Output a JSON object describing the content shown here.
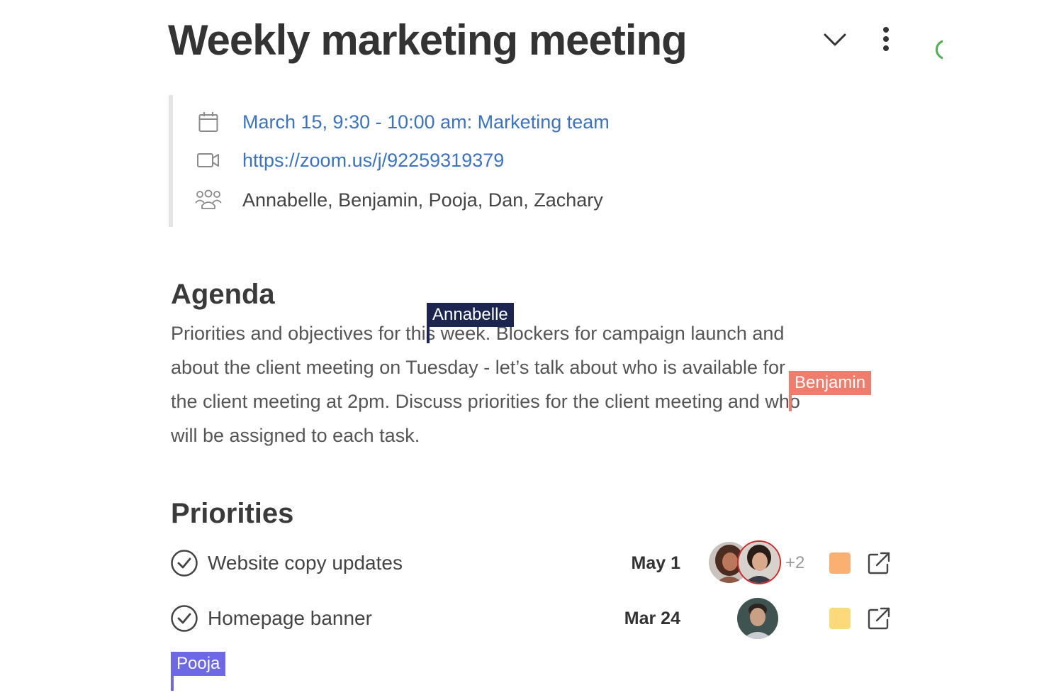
{
  "page": {
    "title": "Weekly marketing meeting",
    "icons": {
      "collapse": "chevron-down-icon",
      "more": "more-vertical-icon"
    }
  },
  "meeting": {
    "event": {
      "icon": "calendar-icon",
      "text": "March 15, 9:30 - 10:00 am: Marketing team"
    },
    "video": {
      "icon": "video-camera-icon",
      "text": "https://zoom.us/j/92259319379"
    },
    "attendees": {
      "icon": "people-icon",
      "text": "Annabelle, Benjamin, Pooja, Dan, Zachary"
    }
  },
  "agenda": {
    "heading": "Agenda",
    "lines": [
      {
        "before_cursor": "Priorities and objectives for",
        "after_cursor": "this week. Blockers for campaign launch and"
      },
      {
        "text": "about the client meeting on Tuesday - let’s talk about who is available for"
      },
      {
        "before_cursor": "the client meeting at 2pm.  Discuss priorities for the client meeting",
        "after_cursor": "and who"
      },
      {
        "text": "will be assigned to each task."
      }
    ]
  },
  "collaborators": {
    "annabelle": {
      "name": "Annabelle",
      "color": "#1b2550"
    },
    "benjamin": {
      "name": "Benjamin",
      "color": "#f07c6c"
    },
    "pooja": {
      "name": "Pooja",
      "color": "#6c68e6"
    }
  },
  "priorities": {
    "heading": "Priorities",
    "tasks": [
      {
        "name": "Website copy updates",
        "due": "May 1",
        "assignees_extra": "+2",
        "color": "#f9b070",
        "check_icon": "check-circle-icon",
        "open_icon": "open-external-icon"
      },
      {
        "name": "Homepage banner",
        "due": "Mar 24",
        "assignees_extra": "",
        "color": "#fcd97a",
        "check_icon": "check-circle-icon",
        "open_icon": "open-external-icon"
      }
    ]
  }
}
